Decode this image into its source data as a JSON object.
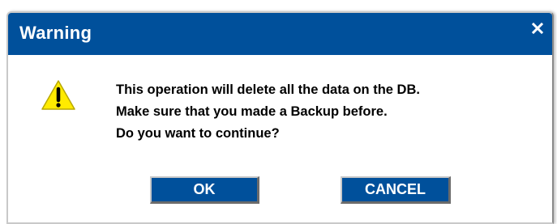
{
  "dialog": {
    "title": "Warning",
    "close_icon": "close-icon",
    "warning_icon": "warning-triangle-icon",
    "message_lines": [
      "This operation will delete all the data on the DB.",
      "Make sure that you made a Backup before.",
      "Do you want to continue?"
    ],
    "ok_label": "OK",
    "cancel_label": "CANCEL"
  },
  "colors": {
    "titlebar": "#00509b",
    "button": "#00509b",
    "warning_fill": "#ffeb00",
    "text": "#000000"
  }
}
